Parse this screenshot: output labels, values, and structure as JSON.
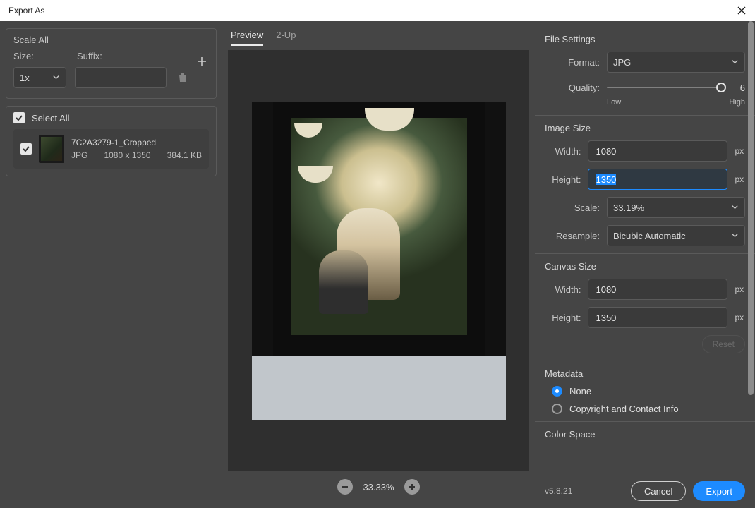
{
  "title": "Export As",
  "left": {
    "scale_all": "Scale All",
    "size_label": "Size:",
    "suffix_label": "Suffix:",
    "size_value": "1x",
    "suffix_value": "",
    "select_all": "Select All",
    "asset": {
      "name": "7C2A3279-1_Cropped",
      "format": "JPG",
      "dimensions": "1080 x 1350",
      "filesize": "384.1 KB"
    }
  },
  "center": {
    "tabs": {
      "preview": "Preview",
      "two_up": "2-Up"
    },
    "zoom": "33.33%"
  },
  "right": {
    "file_settings": "File Settings",
    "format_label": "Format:",
    "format_value": "JPG",
    "quality_label": "Quality:",
    "quality_value": "6",
    "quality_low": "Low",
    "quality_high": "High",
    "image_size": "Image Size",
    "width_label": "Width:",
    "height_label": "Height:",
    "scale_label": "Scale:",
    "resample_label": "Resample:",
    "img_width": "1080",
    "img_height": "1350",
    "scale_value": "33.19%",
    "resample_value": "Bicubic Automatic",
    "px": "px",
    "canvas_size": "Canvas Size",
    "canvas_width": "1080",
    "canvas_height": "1350",
    "reset": "Reset",
    "metadata": "Metadata",
    "meta_none": "None",
    "meta_copyright": "Copyright and Contact Info",
    "color_space": "Color Space"
  },
  "footer": {
    "version": "v5.8.21",
    "cancel": "Cancel",
    "export": "Export"
  }
}
